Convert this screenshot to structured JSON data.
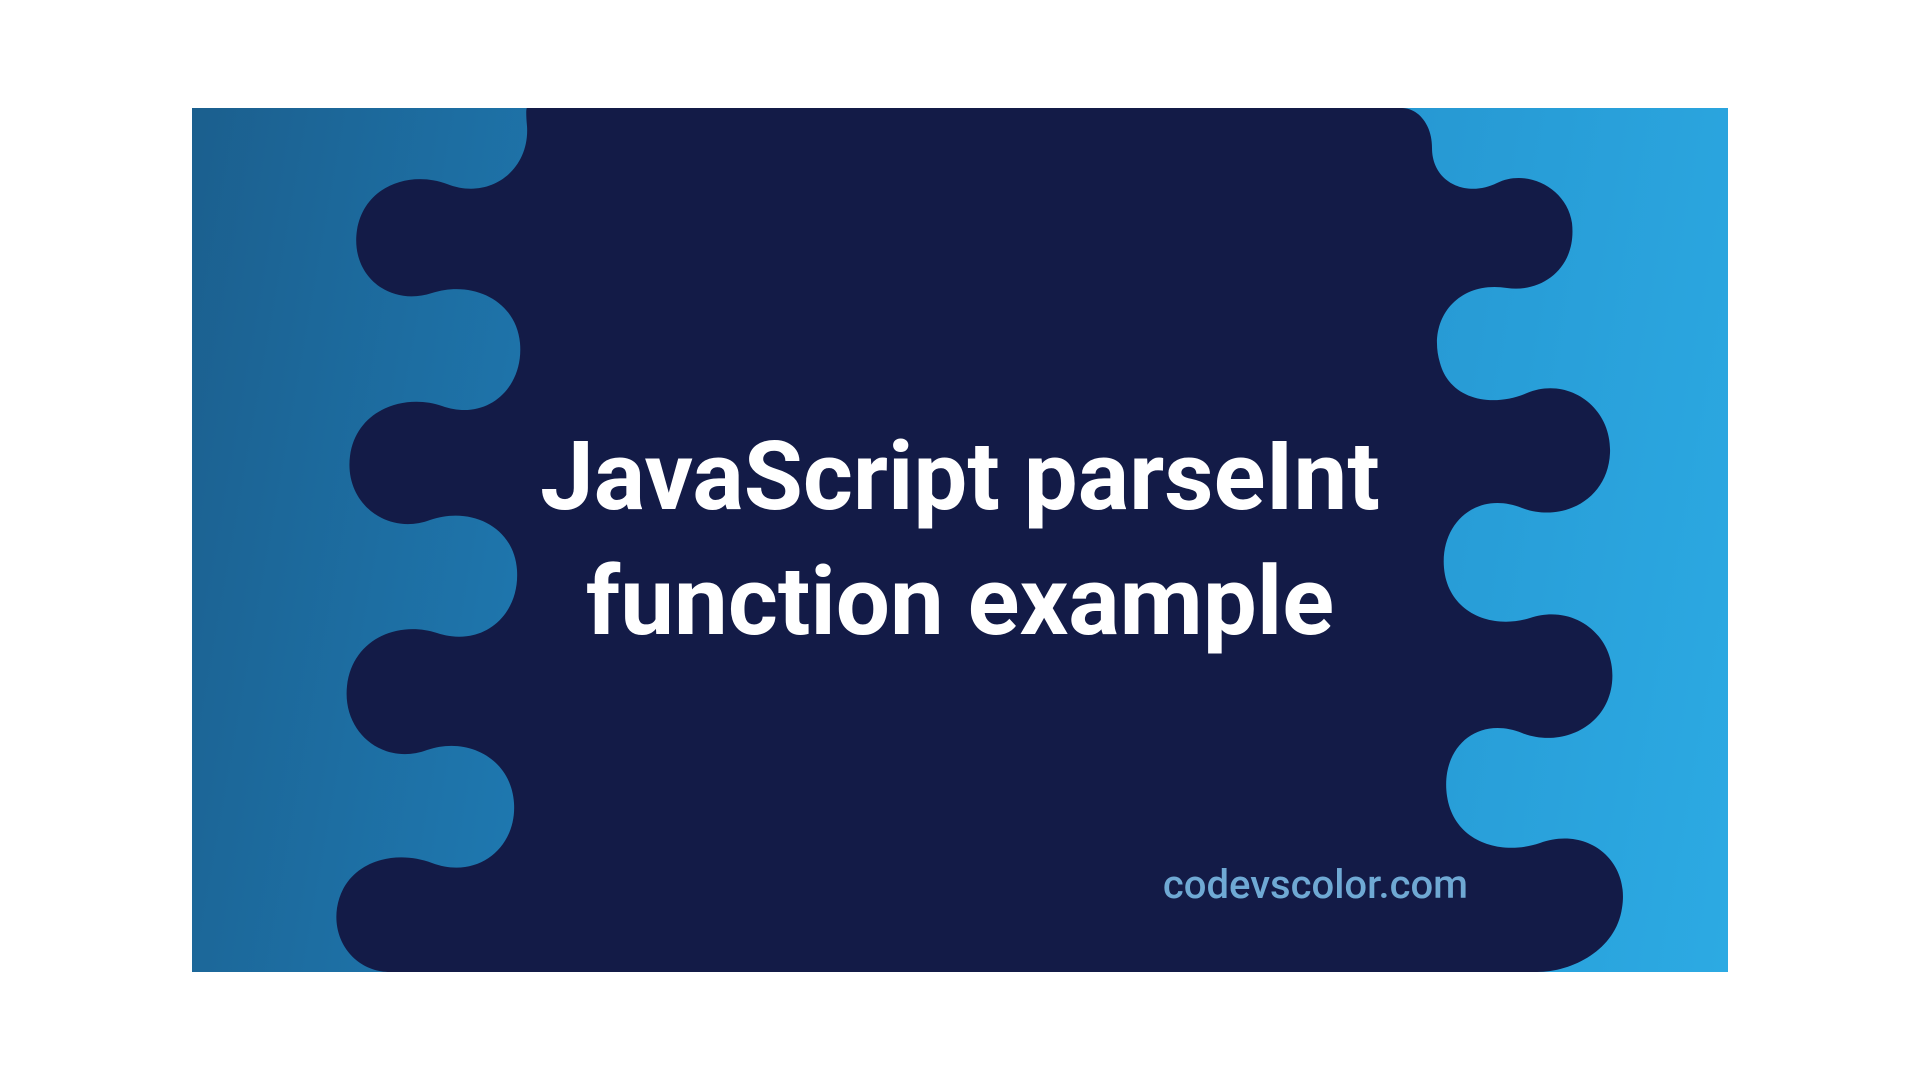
{
  "title": "JavaScript parseInt function example",
  "credit": "codevscolor.com",
  "colors": {
    "blob": "#131b47",
    "text": "#ffffff",
    "credit": "#6fa9d4"
  }
}
